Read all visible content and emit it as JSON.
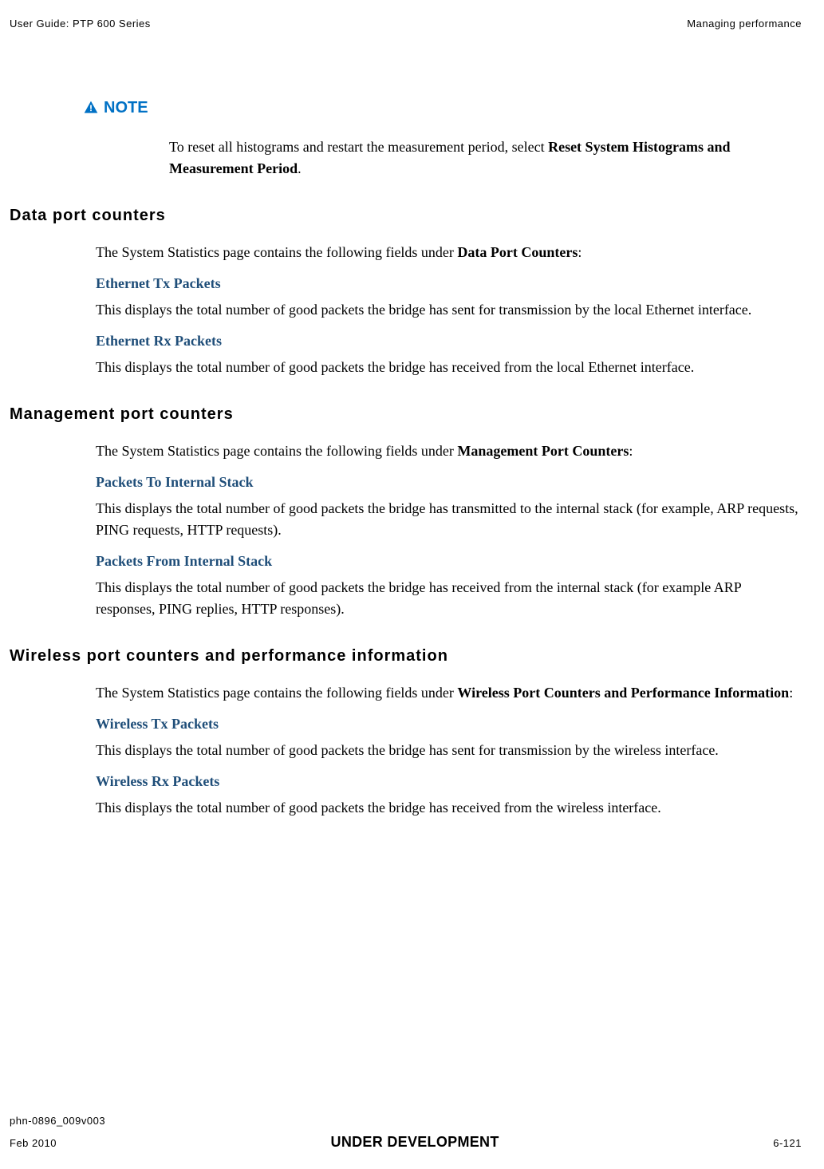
{
  "header": {
    "left": "User Guide: PTP 600 Series",
    "right": "Managing performance"
  },
  "note": {
    "label": "NOTE",
    "text_pre": "To reset all histograms and restart the measurement period, select ",
    "text_bold": "Reset System Histograms and Measurement Period",
    "text_post": "."
  },
  "sections": [
    {
      "heading": "Data port counters",
      "intro_pre": "The System Statistics page contains the following fields under ",
      "intro_bold": "Data Port Counters",
      "intro_post": ":",
      "items": [
        {
          "title": "Ethernet Tx Packets",
          "body": "This displays the total number of good packets the bridge has sent for transmission by the local Ethernet interface."
        },
        {
          "title": "Ethernet Rx Packets",
          "body": "This displays the total number of good packets the bridge has received from the local Ethernet interface."
        }
      ]
    },
    {
      "heading": "Management port counters",
      "intro_pre": "The System Statistics page contains the following fields under ",
      "intro_bold": "Management Port Counters",
      "intro_post": ":",
      "items": [
        {
          "title": "Packets To Internal Stack",
          "body": "This displays the total number of good packets the bridge has transmitted to the internal stack (for example, ARP requests, PING requests, HTTP requests)."
        },
        {
          "title": "Packets From Internal Stack",
          "body": "This displays the total number of good packets the bridge has received from the internal stack (for example ARP responses, PING replies, HTTP responses)."
        }
      ]
    },
    {
      "heading": "Wireless port counters and performance information",
      "intro_pre": "The System Statistics page contains the following fields under ",
      "intro_bold": "Wireless Port Counters and Performance Information",
      "intro_post": ":",
      "items": [
        {
          "title": "Wireless Tx Packets",
          "body": "This displays the total number of good packets the bridge has sent for transmission by the wireless interface."
        },
        {
          "title": "Wireless Rx Packets",
          "body": "This displays the total number of good packets the bridge has received from the wireless interface."
        }
      ]
    }
  ],
  "footer": {
    "doc_id": "phn-0896_009v003",
    "date": "Feb 2010",
    "status": "UNDER DEVELOPMENT",
    "page": "6-121"
  }
}
